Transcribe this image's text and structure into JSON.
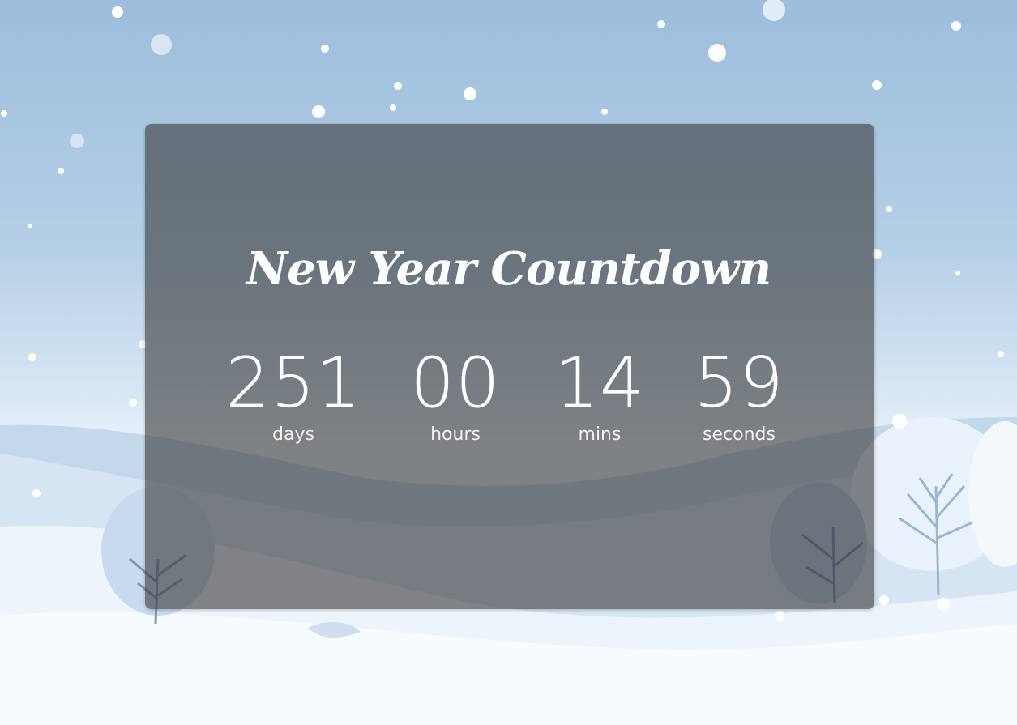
{
  "title": "New Year Countdown",
  "countdown": [
    {
      "value": "251",
      "label": "days"
    },
    {
      "value": "00",
      "label": "hours"
    },
    {
      "value": "14",
      "label": "mins"
    },
    {
      "value": "59",
      "label": "seconds"
    }
  ],
  "colors": {
    "sky_top": "#9cbddc",
    "snow": "#f4f8fc",
    "panel_overlay": "#3c3c3c",
    "text": "#ffffff"
  }
}
